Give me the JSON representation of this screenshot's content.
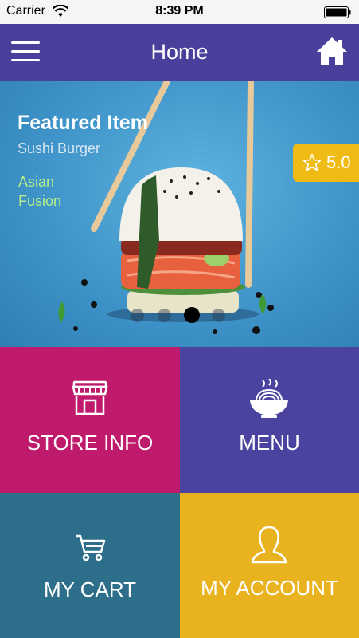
{
  "status_bar": {
    "carrier": "Carrier",
    "time": "8:39 PM"
  },
  "nav": {
    "title": "Home",
    "menu_icon": "hamburger-menu-icon",
    "home_icon": "home-icon"
  },
  "featured": {
    "heading": "Featured Item",
    "name": "Sushi Burger",
    "category_line1": "Asian",
    "category_line2": "Fusion",
    "rating": "5.0",
    "carousel_count": 4,
    "carousel_active": 3
  },
  "tiles": {
    "store_info": "STORE INFO",
    "menu": "MENU",
    "my_cart": "MY CART",
    "my_account": "MY ACCOUNT"
  },
  "colors": {
    "nav": "#4a3f9a",
    "store_tile": "#bf1a6b",
    "menu_tile": "#4a44a0",
    "cart_tile": "#2d6f8a",
    "account_tile": "#e9b21f",
    "rating_badge": "#f0bb14",
    "category_text": "#b6ee8a"
  }
}
